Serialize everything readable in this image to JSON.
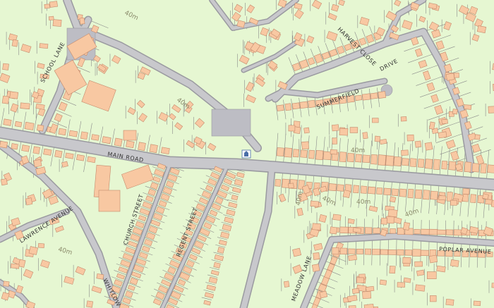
{
  "map": {
    "colors": {
      "land": "#e6f7d2",
      "road": "#c8c8cc",
      "road_edge": "#9a9aa0",
      "building": "#f8c8a2",
      "building_edge": "#c48a6c",
      "parcel_line": "#8a8a8a",
      "parking": "#bdbdc4"
    },
    "street_labels": [
      {
        "name": "school-lane",
        "text": "SCHOOL LANE"
      },
      {
        "name": "harvest-close",
        "text": "HARVEST CLOSE"
      },
      {
        "name": "drive",
        "text": "DRIVE"
      },
      {
        "name": "summerfield",
        "text": "SUMMERFIELD"
      },
      {
        "name": "main-road",
        "text": "MAIN ROAD"
      },
      {
        "name": "church-street",
        "text": "CHURCH STREET"
      },
      {
        "name": "regent-street",
        "text": "REGENT STREET"
      },
      {
        "name": "lawrence-avenue",
        "text": "LAWRENCE AVENUE"
      },
      {
        "name": "whitlow",
        "text": "WHITLOW"
      },
      {
        "name": "meadow-lane",
        "text": "MEADOW LANE"
      },
      {
        "name": "poplar-avenue",
        "text": "POPLAR AVENUE"
      }
    ],
    "contour_labels": [
      {
        "name": "contour-1",
        "text": "40m"
      },
      {
        "name": "contour-2",
        "text": "40m"
      },
      {
        "name": "contour-3",
        "text": "40m"
      },
      {
        "name": "contour-4",
        "text": "40m"
      },
      {
        "name": "contour-5",
        "text": "40m"
      },
      {
        "name": "contour-6",
        "text": "40m"
      },
      {
        "name": "contour-7",
        "text": "40m"
      },
      {
        "name": "contour-8",
        "text": "40m"
      }
    ],
    "icons": [
      "church-icon"
    ]
  }
}
